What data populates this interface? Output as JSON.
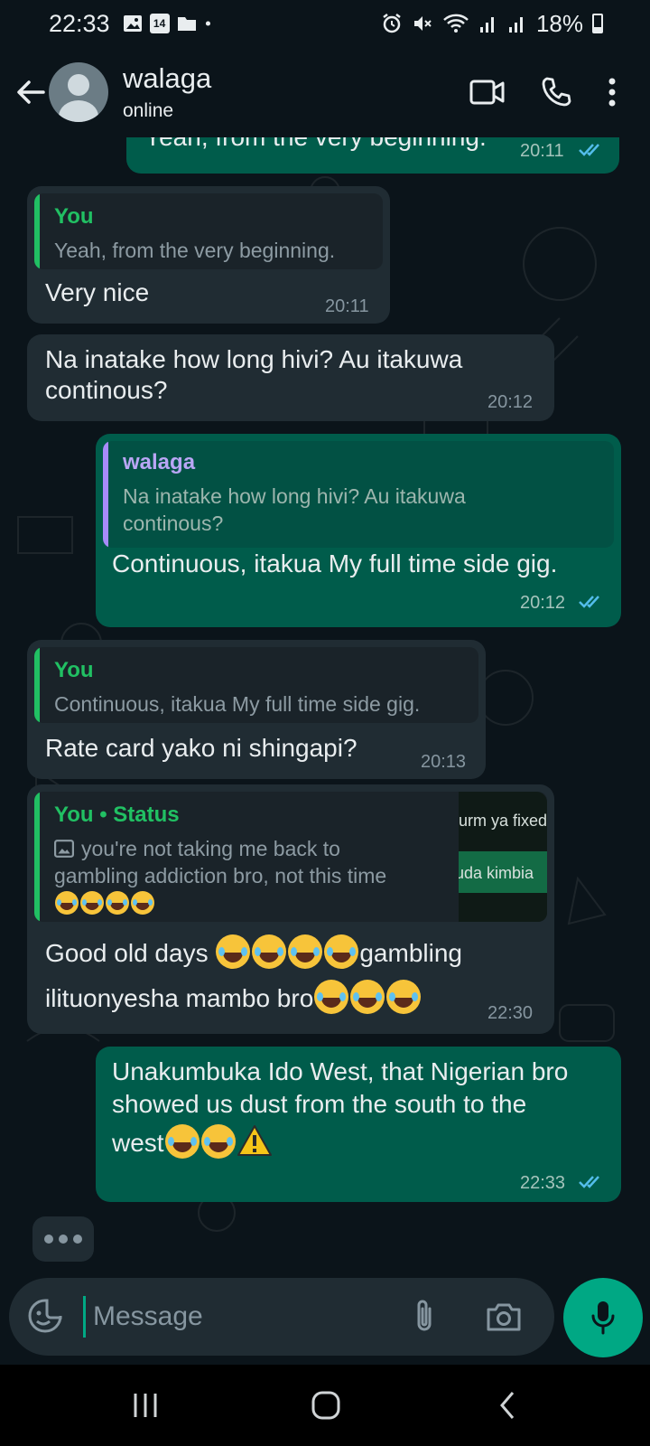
{
  "status_bar": {
    "time": "22:33",
    "calendar_date": "14",
    "battery": "18%",
    "icons": [
      "gallery-icon",
      "calendar-icon",
      "folder-icon",
      "dot-icon",
      "alarm-icon",
      "mute-icon",
      "wifi-icon",
      "signal-icon",
      "signal-icon",
      "battery-icon"
    ]
  },
  "header": {
    "contact_name": "walaga",
    "contact_status": "online",
    "icons": [
      "back-arrow-icon",
      "avatar",
      "video-call-icon",
      "phone-icon",
      "more-vert-icon"
    ]
  },
  "messages": [
    {
      "id": "m0",
      "direction": "out",
      "text": "Yeah, from the very beginning.",
      "time": "20:11",
      "read": true
    },
    {
      "id": "m1",
      "direction": "in",
      "quote_name": "You",
      "quote_text": "Yeah, from the very beginning.",
      "text": "Very nice",
      "time": "20:11"
    },
    {
      "id": "m2",
      "direction": "in",
      "text_line1": "Na inatake how long hivi? Au itakuwa",
      "text_line2": "continous?",
      "time": "20:12"
    },
    {
      "id": "m3",
      "direction": "out",
      "quote_name": "walaga",
      "quote_line1": "Na inatake how long hivi? Au itakuwa",
      "quote_line2": "continous?",
      "text": "Continuous, itakua My full time side gig.",
      "time": "20:12",
      "read": true
    },
    {
      "id": "m4",
      "direction": "in",
      "quote_name": "You",
      "quote_text": "Continuous, itakua My full time side gig.",
      "text": "Rate card yako ni shingapi?",
      "time": "20:13"
    },
    {
      "id": "m5",
      "direction": "in",
      "quote_name": "You • Status",
      "quote_line1": "you're not taking me back to",
      "quote_line2": "gambling addiction bro, not this time",
      "thumb_line1": "urm ya fixed",
      "thumb_line2": "uda kimbia",
      "text_line1_a": "Good old days ",
      "text_line1_b": "gambling",
      "text_line2": "ilituonyesha mambo bro",
      "time": "22:30"
    },
    {
      "id": "m6",
      "direction": "out",
      "text_line1": "Unakumbuka Ido West,  that Nigerian bro",
      "text_line2": "showed us dust from the south to the",
      "text_line3": "west",
      "time": "22:33",
      "read": true
    }
  ],
  "composer": {
    "placeholder": "Message",
    "icons": [
      "emoji-sticker-icon",
      "attach-icon",
      "camera-icon",
      "mic-icon"
    ]
  },
  "nav": {
    "icons": [
      "recents-icon",
      "home-icon",
      "back-icon"
    ]
  },
  "colors": {
    "background": "#0b141a",
    "incoming_bubble": "#202c33",
    "outgoing_bubble": "#005c4b",
    "accent_green": "#00a884",
    "read_ticks": "#53bdeb",
    "quote_you": "#21c063",
    "quote_walaga": "#a78bfa"
  }
}
